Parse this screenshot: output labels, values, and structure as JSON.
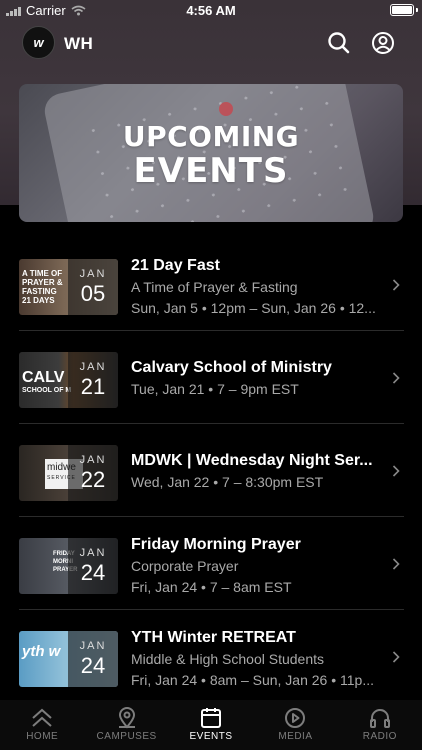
{
  "status": {
    "carrier": "Carrier",
    "time": "4:56 AM"
  },
  "header": {
    "logo_text": "w",
    "title": "WH",
    "icons": [
      "search-icon",
      "profile-icon"
    ]
  },
  "banner": {
    "line1": "UPCOMING",
    "line2": "EVENTS"
  },
  "events": [
    {
      "title": "21 Day Fast",
      "subtitle": "A Time of Prayer & Fasting",
      "when": "Sun, Jan 5 • 12pm – Sun, Jan 26 • 12...",
      "month": "JAN",
      "day": "05",
      "thumb_text": "A TIME OF\nPRAYER &\nFASTING\n21 DAYS"
    },
    {
      "title": "Calvary School of Ministry",
      "subtitle": "",
      "when": "Tue, Jan 21 • 7 – 9pm EST",
      "month": "JAN",
      "day": "21",
      "thumb_text": "CALV\nSCHOOL OF M"
    },
    {
      "title": "MDWK | Wednesday Night Ser...",
      "subtitle": "",
      "when": "Wed, Jan 22 • 7 – 8:30pm EST",
      "month": "JAN",
      "day": "22",
      "thumb_text": "midwe\nSERVICE"
    },
    {
      "title": "Friday Morning Prayer",
      "subtitle": "Corporate Prayer",
      "when": "Fri, Jan 24 • 7 – 8am EST",
      "month": "JAN",
      "day": "24",
      "thumb_text": "FRIDAY\nMORNI\nPRAYER"
    },
    {
      "title": "YTH Winter RETREAT",
      "subtitle": "Middle & High School Students",
      "when": "Fri, Jan 24 • 8am – Sun, Jan 26 • 11p...",
      "month": "JAN",
      "day": "24",
      "thumb_text": "yth w"
    }
  ],
  "tabs": [
    {
      "label": "HOME",
      "icon": "home-chevrons-icon",
      "active": false
    },
    {
      "label": "CAMPUSES",
      "icon": "location-pin-icon",
      "active": false
    },
    {
      "label": "EVENTS",
      "icon": "calendar-icon",
      "active": true
    },
    {
      "label": "MEDIA",
      "icon": "play-circle-icon",
      "active": false
    },
    {
      "label": "RADIO",
      "icon": "headphones-icon",
      "active": false
    }
  ],
  "colors": {
    "background": "#000000",
    "header_bg": "#3a3238",
    "text_secondary": "#a9a9a9",
    "tab_inactive": "#7d7d7d"
  }
}
